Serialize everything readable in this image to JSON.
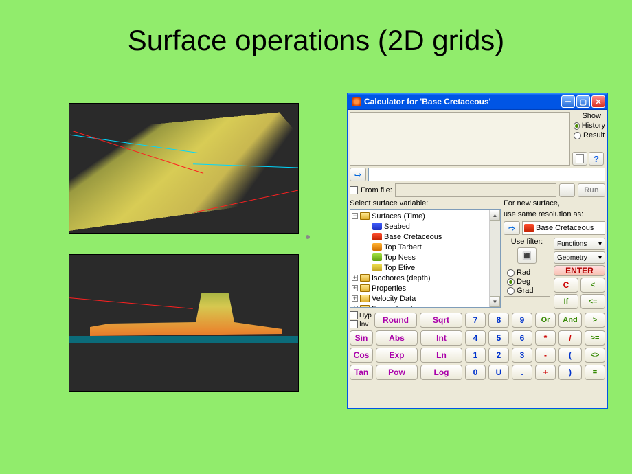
{
  "slide": {
    "title": "Surface operations (2D grids)"
  },
  "window": {
    "title": "Calculator for 'Base Cretaceous'",
    "show_label": "Show",
    "show_options": {
      "history": "History",
      "result": "Result"
    },
    "from_file": "From file:",
    "browse": "...",
    "run": "Run",
    "tree_label": "Select surface variable:",
    "tree": {
      "root": "Surfaces (Time)",
      "items": [
        "Seabed",
        "Base Cretaceous",
        "Top Tarbert",
        "Top Ness",
        "Top Etive"
      ],
      "folders": [
        "Isochores (depth)",
        "Properties",
        "Velocity Data",
        "Facies Input"
      ]
    },
    "resolution": {
      "l1": "For new surface,",
      "l2": "use same resolution as:",
      "value": "Base Cretaceous"
    },
    "filter_label": "Use filter:",
    "dropdowns": {
      "functions": "Functions",
      "geometry": "Geometry"
    },
    "ops": {
      "enter": "ENTER",
      "c": "C",
      "if": "If"
    },
    "units": {
      "rad": "Rad",
      "deg": "Deg",
      "grad": "Grad"
    },
    "hyp": "Hyp",
    "inv": "Inv",
    "keys": {
      "round": "Round",
      "sqrt": "Sqrt",
      "n7": "7",
      "n8": "8",
      "n9": "9",
      "or": "Or",
      "and": "And",
      "gt": ">",
      "sin": "Sin",
      "abs": "Abs",
      "int": "Int",
      "n4": "4",
      "n5": "5",
      "n6": "6",
      "mul": "*",
      "div": "/",
      "ge": ">=",
      "cos": "Cos",
      "exp": "Exp",
      "ln": "Ln",
      "n1": "1",
      "n2": "2",
      "n3": "3",
      "sub": "-",
      "lp": "(",
      "ne": "<>",
      "tan": "Tan",
      "pow": "Pow",
      "log": "Log",
      "n0": "0",
      "u": "U",
      "dot": ".",
      "add": "+",
      "rp": ")",
      "eq": "=",
      "lt": "<",
      "le": "<="
    }
  }
}
